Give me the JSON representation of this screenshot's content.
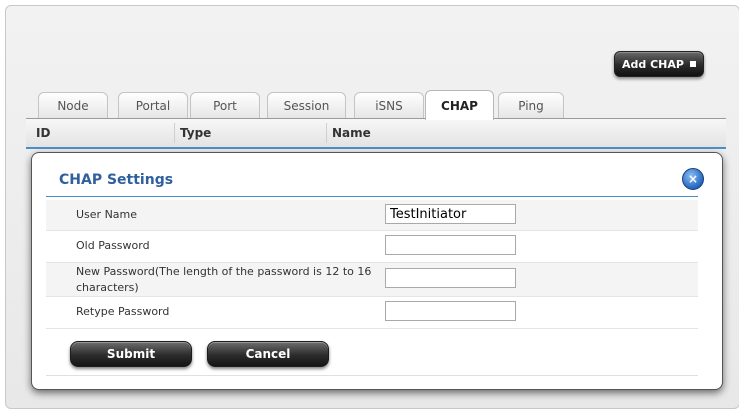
{
  "toolbar": {
    "add_chap_label": "Add CHAP"
  },
  "tabs": [
    {
      "label": "Node",
      "active": false
    },
    {
      "label": "Portal",
      "active": false
    },
    {
      "label": "Port",
      "active": false
    },
    {
      "label": "Session",
      "active": false
    },
    {
      "label": "iSNS",
      "active": false
    },
    {
      "label": "CHAP",
      "active": true
    },
    {
      "label": "Ping",
      "active": false
    }
  ],
  "grid": {
    "columns": [
      "ID",
      "Type",
      "Name"
    ]
  },
  "modal": {
    "title": "CHAP Settings",
    "close_icon": "close-icon",
    "fields": [
      {
        "label": "User Name",
        "value": "TestInitiator"
      },
      {
        "label": "Old Password",
        "value": ""
      },
      {
        "label": "New Password(The length of the password is 12 to 16 characters)",
        "value": ""
      },
      {
        "label": "Retype Password",
        "value": ""
      }
    ],
    "submit_label": "Submit",
    "cancel_label": "Cancel"
  },
  "colors": {
    "accent": "#2f5f9e",
    "header_rule": "#4a90c8",
    "button_dark": "#2c2c2c"
  }
}
